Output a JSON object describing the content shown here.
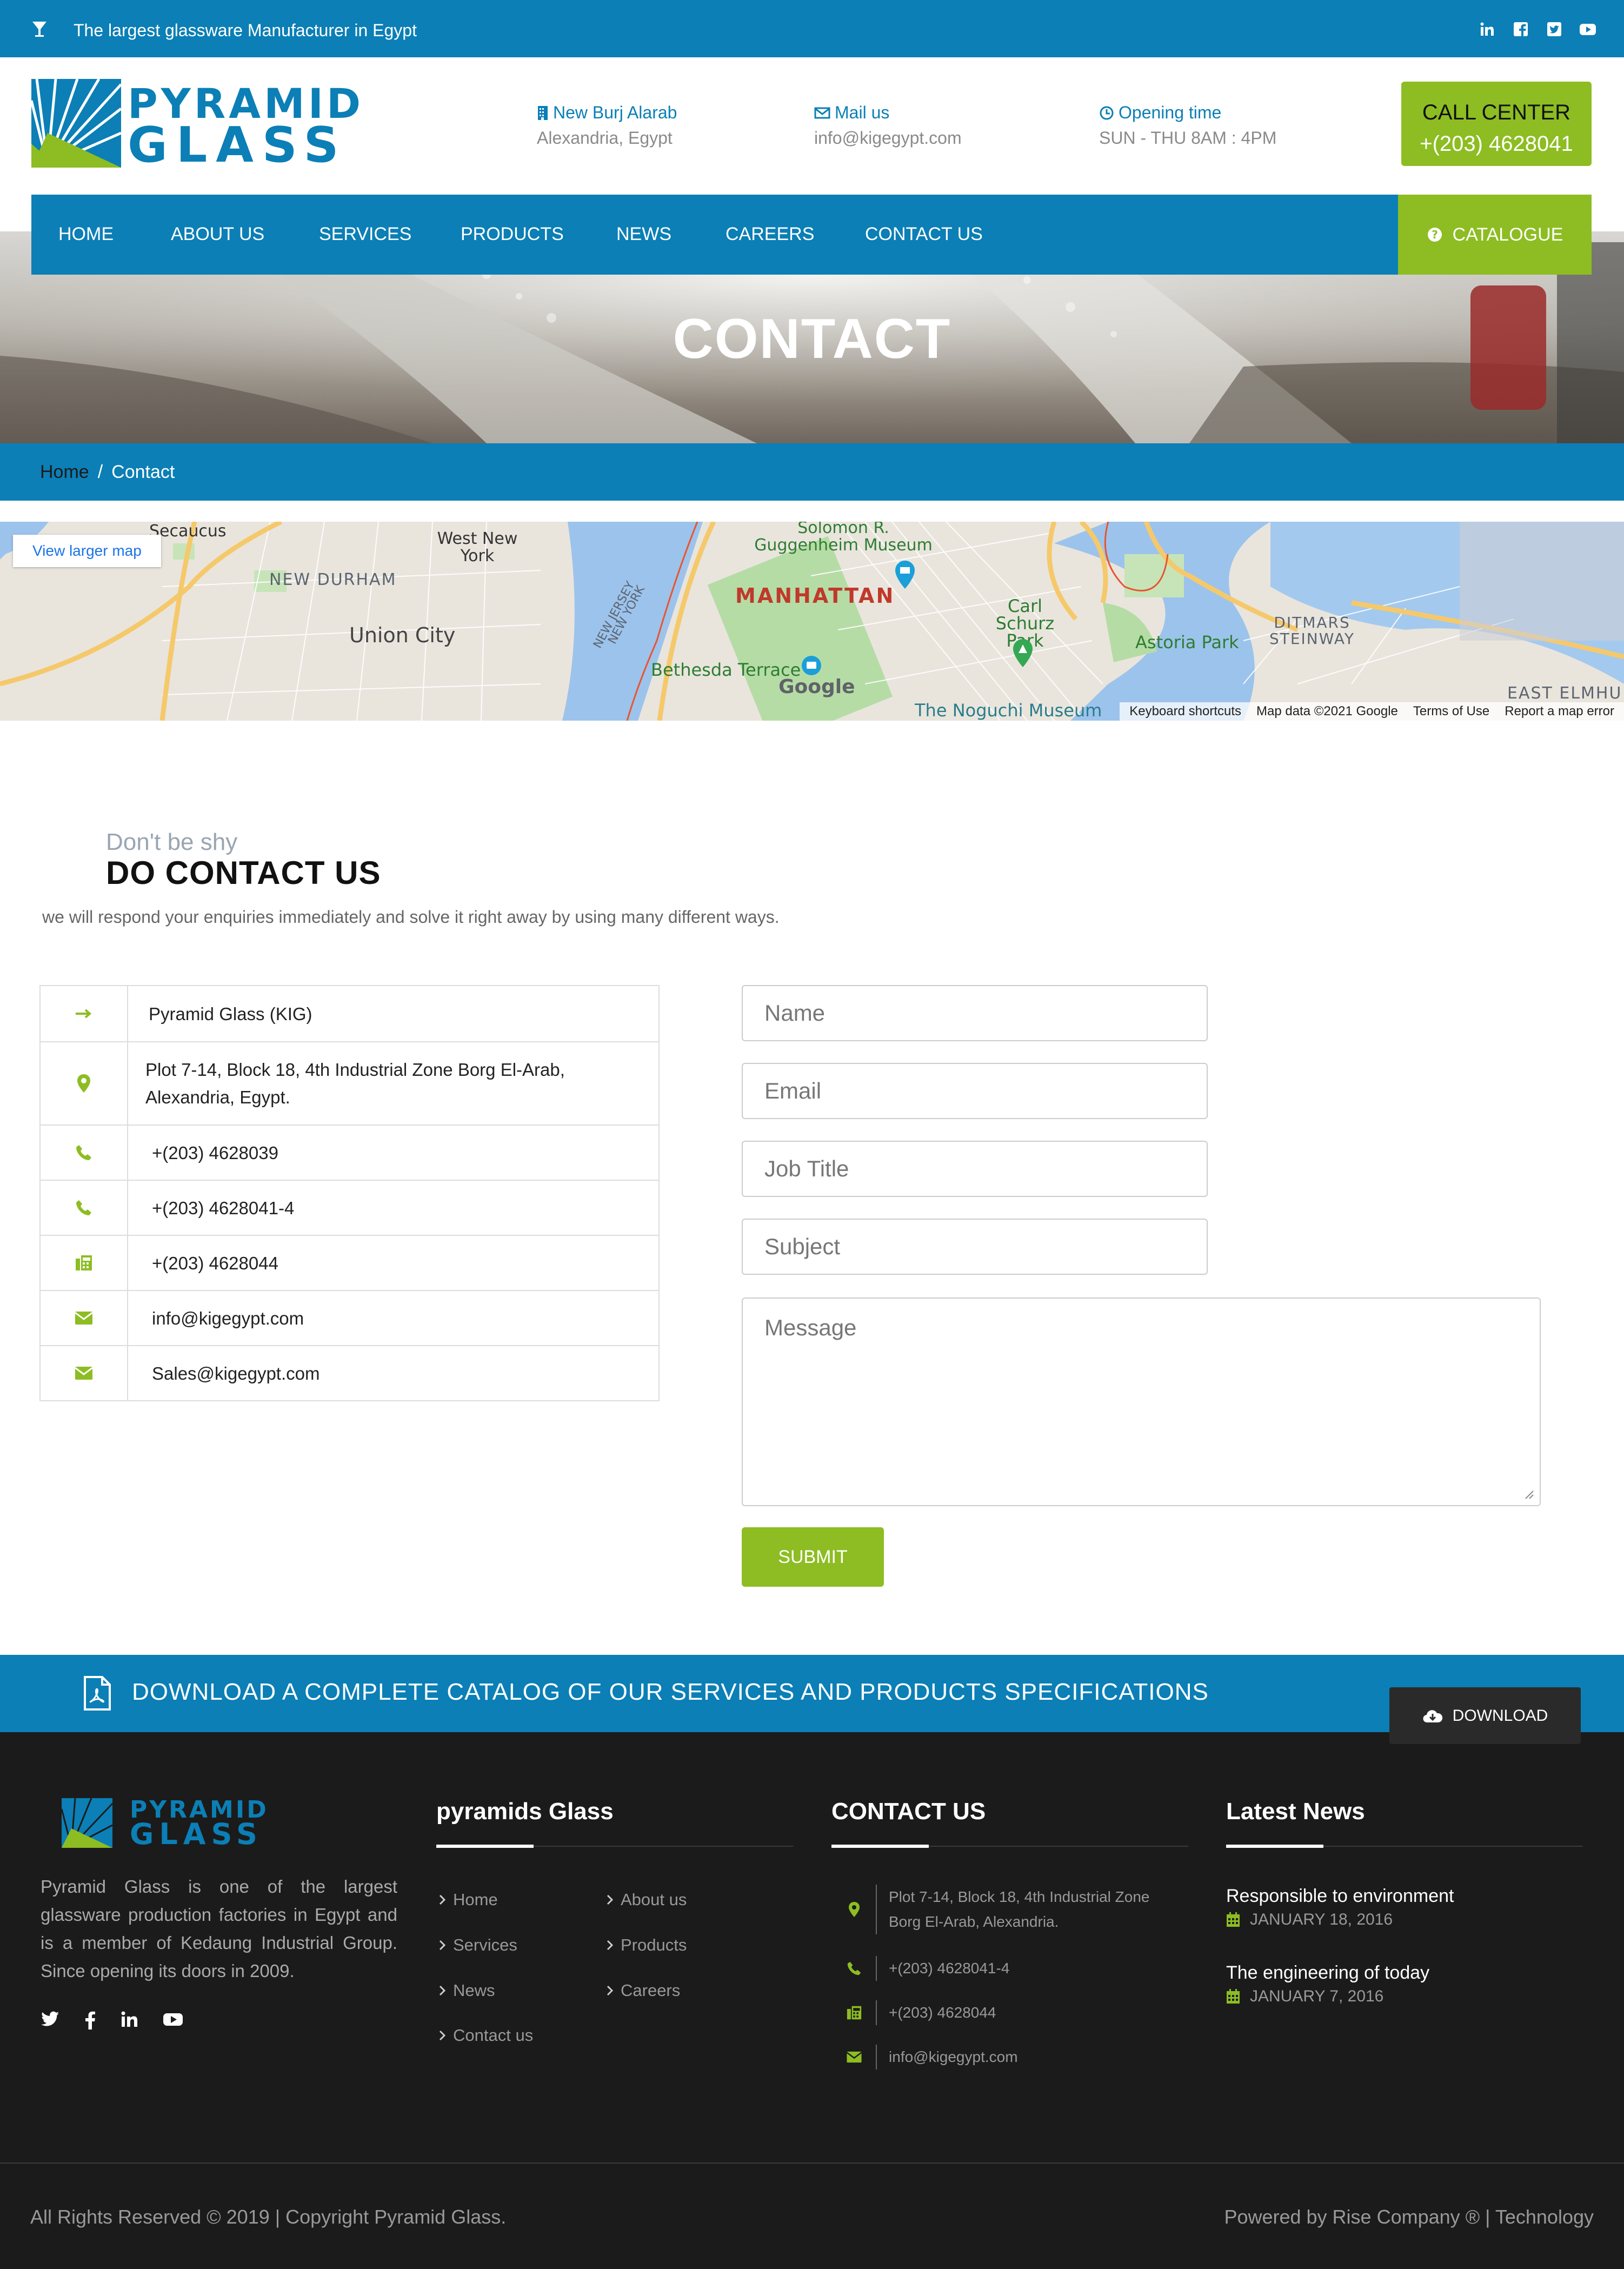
{
  "topbar": {
    "tagline": "The largest glassware Manufacturer in Egypt",
    "socials": [
      "linkedin-icon",
      "facebook-icon",
      "twitter-icon",
      "youtube-icon"
    ]
  },
  "brand": {
    "line1": "PYRAMID",
    "line2": "GLASS"
  },
  "header": {
    "location_title": "New Burj Alarab",
    "location_value": "Alexandria, Egypt",
    "mail_title": "Mail us",
    "mail_value": "info@kigegypt.com",
    "hours_title": "Opening time",
    "hours_value": "SUN - THU 8AM : 4PM",
    "call_label": "CALL CENTER",
    "call_number": "+(203) 4628041"
  },
  "nav": {
    "items": [
      "HOME",
      "ABOUT US",
      "SERVICES",
      "PRODUCTS",
      "NEWS",
      "CAREERS",
      "CONTACT US"
    ],
    "catalogue": "CATALOGUE"
  },
  "hero": {
    "title": "CONTACT"
  },
  "breadcrumb": {
    "home": "Home",
    "sep": "/",
    "current": "Contact"
  },
  "map": {
    "view_larger": "View larger map",
    "labels": [
      "Secaucus",
      "West New York",
      "NEW DURHAM",
      "Union City",
      "MANHATTAN",
      "Solomon R. Guggenheim Museum",
      "Carl Schurz Park",
      "Astoria Park",
      "DITMARS STEINWAY",
      "Bethesda Terrace",
      "The Noguchi Museum",
      "EAST ELMHU",
      "NEW JERSEY",
      "NEW YORK",
      "Google"
    ],
    "footer": [
      "Keyboard shortcuts",
      "Map data ©2021 Google",
      "Terms of Use",
      "Report a map error"
    ]
  },
  "contact": {
    "kicker": "Don't be shy",
    "heading": "DO CONTACT US",
    "intro": "we will respond your enquiries immediately and solve it right away by using many different ways.",
    "info": [
      {
        "icon": "arrow-right-icon",
        "text": "Pyramid Glass (KIG)"
      },
      {
        "icon": "map-pin-icon",
        "text": "Plot 7-14, Block 18, 4th Industrial Zone Borg El-Arab, Alexandria, Egypt."
      },
      {
        "icon": "phone-icon",
        "text": "+(203) 4628039"
      },
      {
        "icon": "phone-icon",
        "text": "+(203) 4628041-4"
      },
      {
        "icon": "fax-icon",
        "text": "+(203) 4628044"
      },
      {
        "icon": "envelope-icon",
        "text": "info@kigegypt.com"
      },
      {
        "icon": "envelope-icon",
        "text": "Sales@kigegypt.com"
      }
    ],
    "form": {
      "name": "Name",
      "email": "Email",
      "job": "Job Title",
      "subject": "Subject",
      "message": "Message",
      "submit": "SUBMIT"
    }
  },
  "download": {
    "text": "DOWNLOAD A COMPLETE CATALOG OF OUR SERVICES AND PRODUCTS SPECIFICATIONS",
    "button": "DOWNLOAD"
  },
  "footer": {
    "about": "Pyramid Glass is one of the largest glassware production factories in Egypt and is a member of Kedaung Industrial Group. Since opening its doors in 2009.",
    "links_title": "pyramids Glass",
    "links": [
      "Home",
      "About us",
      "Services",
      "Products",
      "News",
      "Careers",
      "Contact us"
    ],
    "contact_title": "CONTACT US",
    "contact": [
      {
        "icon": "map-pin-icon",
        "text": "Plot 7-14, Block 18, 4th Industrial Zone Borg El-Arab, Alexandria."
      },
      {
        "icon": "phone-icon",
        "text": "+(203) 4628041-4"
      },
      {
        "icon": "fax-icon",
        "text": "+(203) 4628044"
      },
      {
        "icon": "envelope-icon",
        "text": "info@kigegypt.com"
      }
    ],
    "news_title": "Latest News",
    "news": [
      {
        "title": "Responsible to environment",
        "date": "JANUARY 18, 2016"
      },
      {
        "title": "The engineering of today",
        "date": "JANUARY 7, 2016"
      }
    ],
    "copyright": "All Rights Reserved © 2019 | Copyright Pyramid Glass.",
    "powered": "Powered by Rise Company ® | Technology"
  },
  "colors": {
    "blue": "#0b7fb6",
    "green": "#8dbd22",
    "dark": "#1b1b1b"
  }
}
